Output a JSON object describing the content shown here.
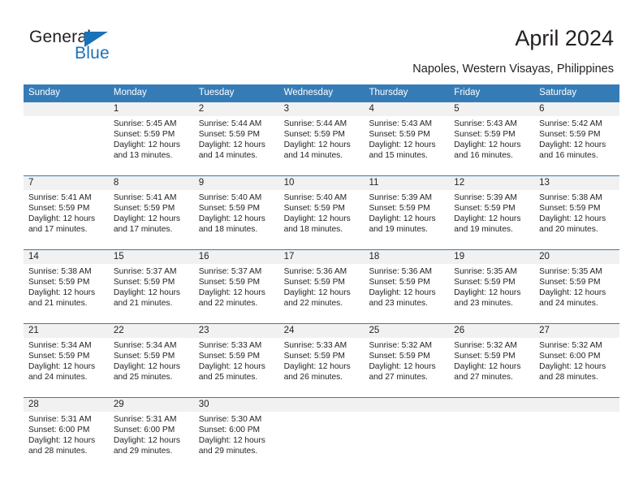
{
  "brand": {
    "name_part1": "General",
    "name_part2": "Blue",
    "triangle_color": "#1b72b8",
    "text_color": "#231f20"
  },
  "header": {
    "title": "April 2024",
    "subtitle": "Napoles, Western Visayas, Philippines"
  },
  "colors": {
    "header_blue": "#357cb7",
    "daynum_bg": "#f1f1f1",
    "text": "#231f20"
  },
  "calendar": {
    "weekdays": [
      "Sunday",
      "Monday",
      "Tuesday",
      "Wednesday",
      "Thursday",
      "Friday",
      "Saturday"
    ],
    "weeks": [
      [
        {
          "day": "",
          "sunrise": "",
          "sunset": "",
          "daylight_line1": "",
          "daylight_line2": ""
        },
        {
          "day": "1",
          "sunrise": "Sunrise: 5:45 AM",
          "sunset": "Sunset: 5:59 PM",
          "daylight_line1": "Daylight: 12 hours",
          "daylight_line2": "and 13 minutes."
        },
        {
          "day": "2",
          "sunrise": "Sunrise: 5:44 AM",
          "sunset": "Sunset: 5:59 PM",
          "daylight_line1": "Daylight: 12 hours",
          "daylight_line2": "and 14 minutes."
        },
        {
          "day": "3",
          "sunrise": "Sunrise: 5:44 AM",
          "sunset": "Sunset: 5:59 PM",
          "daylight_line1": "Daylight: 12 hours",
          "daylight_line2": "and 14 minutes."
        },
        {
          "day": "4",
          "sunrise": "Sunrise: 5:43 AM",
          "sunset": "Sunset: 5:59 PM",
          "daylight_line1": "Daylight: 12 hours",
          "daylight_line2": "and 15 minutes."
        },
        {
          "day": "5",
          "sunrise": "Sunrise: 5:43 AM",
          "sunset": "Sunset: 5:59 PM",
          "daylight_line1": "Daylight: 12 hours",
          "daylight_line2": "and 16 minutes."
        },
        {
          "day": "6",
          "sunrise": "Sunrise: 5:42 AM",
          "sunset": "Sunset: 5:59 PM",
          "daylight_line1": "Daylight: 12 hours",
          "daylight_line2": "and 16 minutes."
        }
      ],
      [
        {
          "day": "7",
          "sunrise": "Sunrise: 5:41 AM",
          "sunset": "Sunset: 5:59 PM",
          "daylight_line1": "Daylight: 12 hours",
          "daylight_line2": "and 17 minutes."
        },
        {
          "day": "8",
          "sunrise": "Sunrise: 5:41 AM",
          "sunset": "Sunset: 5:59 PM",
          "daylight_line1": "Daylight: 12 hours",
          "daylight_line2": "and 17 minutes."
        },
        {
          "day": "9",
          "sunrise": "Sunrise: 5:40 AM",
          "sunset": "Sunset: 5:59 PM",
          "daylight_line1": "Daylight: 12 hours",
          "daylight_line2": "and 18 minutes."
        },
        {
          "day": "10",
          "sunrise": "Sunrise: 5:40 AM",
          "sunset": "Sunset: 5:59 PM",
          "daylight_line1": "Daylight: 12 hours",
          "daylight_line2": "and 18 minutes."
        },
        {
          "day": "11",
          "sunrise": "Sunrise: 5:39 AM",
          "sunset": "Sunset: 5:59 PM",
          "daylight_line1": "Daylight: 12 hours",
          "daylight_line2": "and 19 minutes."
        },
        {
          "day": "12",
          "sunrise": "Sunrise: 5:39 AM",
          "sunset": "Sunset: 5:59 PM",
          "daylight_line1": "Daylight: 12 hours",
          "daylight_line2": "and 19 minutes."
        },
        {
          "day": "13",
          "sunrise": "Sunrise: 5:38 AM",
          "sunset": "Sunset: 5:59 PM",
          "daylight_line1": "Daylight: 12 hours",
          "daylight_line2": "and 20 minutes."
        }
      ],
      [
        {
          "day": "14",
          "sunrise": "Sunrise: 5:38 AM",
          "sunset": "Sunset: 5:59 PM",
          "daylight_line1": "Daylight: 12 hours",
          "daylight_line2": "and 21 minutes."
        },
        {
          "day": "15",
          "sunrise": "Sunrise: 5:37 AM",
          "sunset": "Sunset: 5:59 PM",
          "daylight_line1": "Daylight: 12 hours",
          "daylight_line2": "and 21 minutes."
        },
        {
          "day": "16",
          "sunrise": "Sunrise: 5:37 AM",
          "sunset": "Sunset: 5:59 PM",
          "daylight_line1": "Daylight: 12 hours",
          "daylight_line2": "and 22 minutes."
        },
        {
          "day": "17",
          "sunrise": "Sunrise: 5:36 AM",
          "sunset": "Sunset: 5:59 PM",
          "daylight_line1": "Daylight: 12 hours",
          "daylight_line2": "and 22 minutes."
        },
        {
          "day": "18",
          "sunrise": "Sunrise: 5:36 AM",
          "sunset": "Sunset: 5:59 PM",
          "daylight_line1": "Daylight: 12 hours",
          "daylight_line2": "and 23 minutes."
        },
        {
          "day": "19",
          "sunrise": "Sunrise: 5:35 AM",
          "sunset": "Sunset: 5:59 PM",
          "daylight_line1": "Daylight: 12 hours",
          "daylight_line2": "and 23 minutes."
        },
        {
          "day": "20",
          "sunrise": "Sunrise: 5:35 AM",
          "sunset": "Sunset: 5:59 PM",
          "daylight_line1": "Daylight: 12 hours",
          "daylight_line2": "and 24 minutes."
        }
      ],
      [
        {
          "day": "21",
          "sunrise": "Sunrise: 5:34 AM",
          "sunset": "Sunset: 5:59 PM",
          "daylight_line1": "Daylight: 12 hours",
          "daylight_line2": "and 24 minutes."
        },
        {
          "day": "22",
          "sunrise": "Sunrise: 5:34 AM",
          "sunset": "Sunset: 5:59 PM",
          "daylight_line1": "Daylight: 12 hours",
          "daylight_line2": "and 25 minutes."
        },
        {
          "day": "23",
          "sunrise": "Sunrise: 5:33 AM",
          "sunset": "Sunset: 5:59 PM",
          "daylight_line1": "Daylight: 12 hours",
          "daylight_line2": "and 25 minutes."
        },
        {
          "day": "24",
          "sunrise": "Sunrise: 5:33 AM",
          "sunset": "Sunset: 5:59 PM",
          "daylight_line1": "Daylight: 12 hours",
          "daylight_line2": "and 26 minutes."
        },
        {
          "day": "25",
          "sunrise": "Sunrise: 5:32 AM",
          "sunset": "Sunset: 5:59 PM",
          "daylight_line1": "Daylight: 12 hours",
          "daylight_line2": "and 27 minutes."
        },
        {
          "day": "26",
          "sunrise": "Sunrise: 5:32 AM",
          "sunset": "Sunset: 5:59 PM",
          "daylight_line1": "Daylight: 12 hours",
          "daylight_line2": "and 27 minutes."
        },
        {
          "day": "27",
          "sunrise": "Sunrise: 5:32 AM",
          "sunset": "Sunset: 6:00 PM",
          "daylight_line1": "Daylight: 12 hours",
          "daylight_line2": "and 28 minutes."
        }
      ],
      [
        {
          "day": "28",
          "sunrise": "Sunrise: 5:31 AM",
          "sunset": "Sunset: 6:00 PM",
          "daylight_line1": "Daylight: 12 hours",
          "daylight_line2": "and 28 minutes."
        },
        {
          "day": "29",
          "sunrise": "Sunrise: 5:31 AM",
          "sunset": "Sunset: 6:00 PM",
          "daylight_line1": "Daylight: 12 hours",
          "daylight_line2": "and 29 minutes."
        },
        {
          "day": "30",
          "sunrise": "Sunrise: 5:30 AM",
          "sunset": "Sunset: 6:00 PM",
          "daylight_line1": "Daylight: 12 hours",
          "daylight_line2": "and 29 minutes."
        },
        {
          "day": "",
          "sunrise": "",
          "sunset": "",
          "daylight_line1": "",
          "daylight_line2": ""
        },
        {
          "day": "",
          "sunrise": "",
          "sunset": "",
          "daylight_line1": "",
          "daylight_line2": ""
        },
        {
          "day": "",
          "sunrise": "",
          "sunset": "",
          "daylight_line1": "",
          "daylight_line2": ""
        },
        {
          "day": "",
          "sunrise": "",
          "sunset": "",
          "daylight_line1": "",
          "daylight_line2": ""
        }
      ]
    ]
  }
}
